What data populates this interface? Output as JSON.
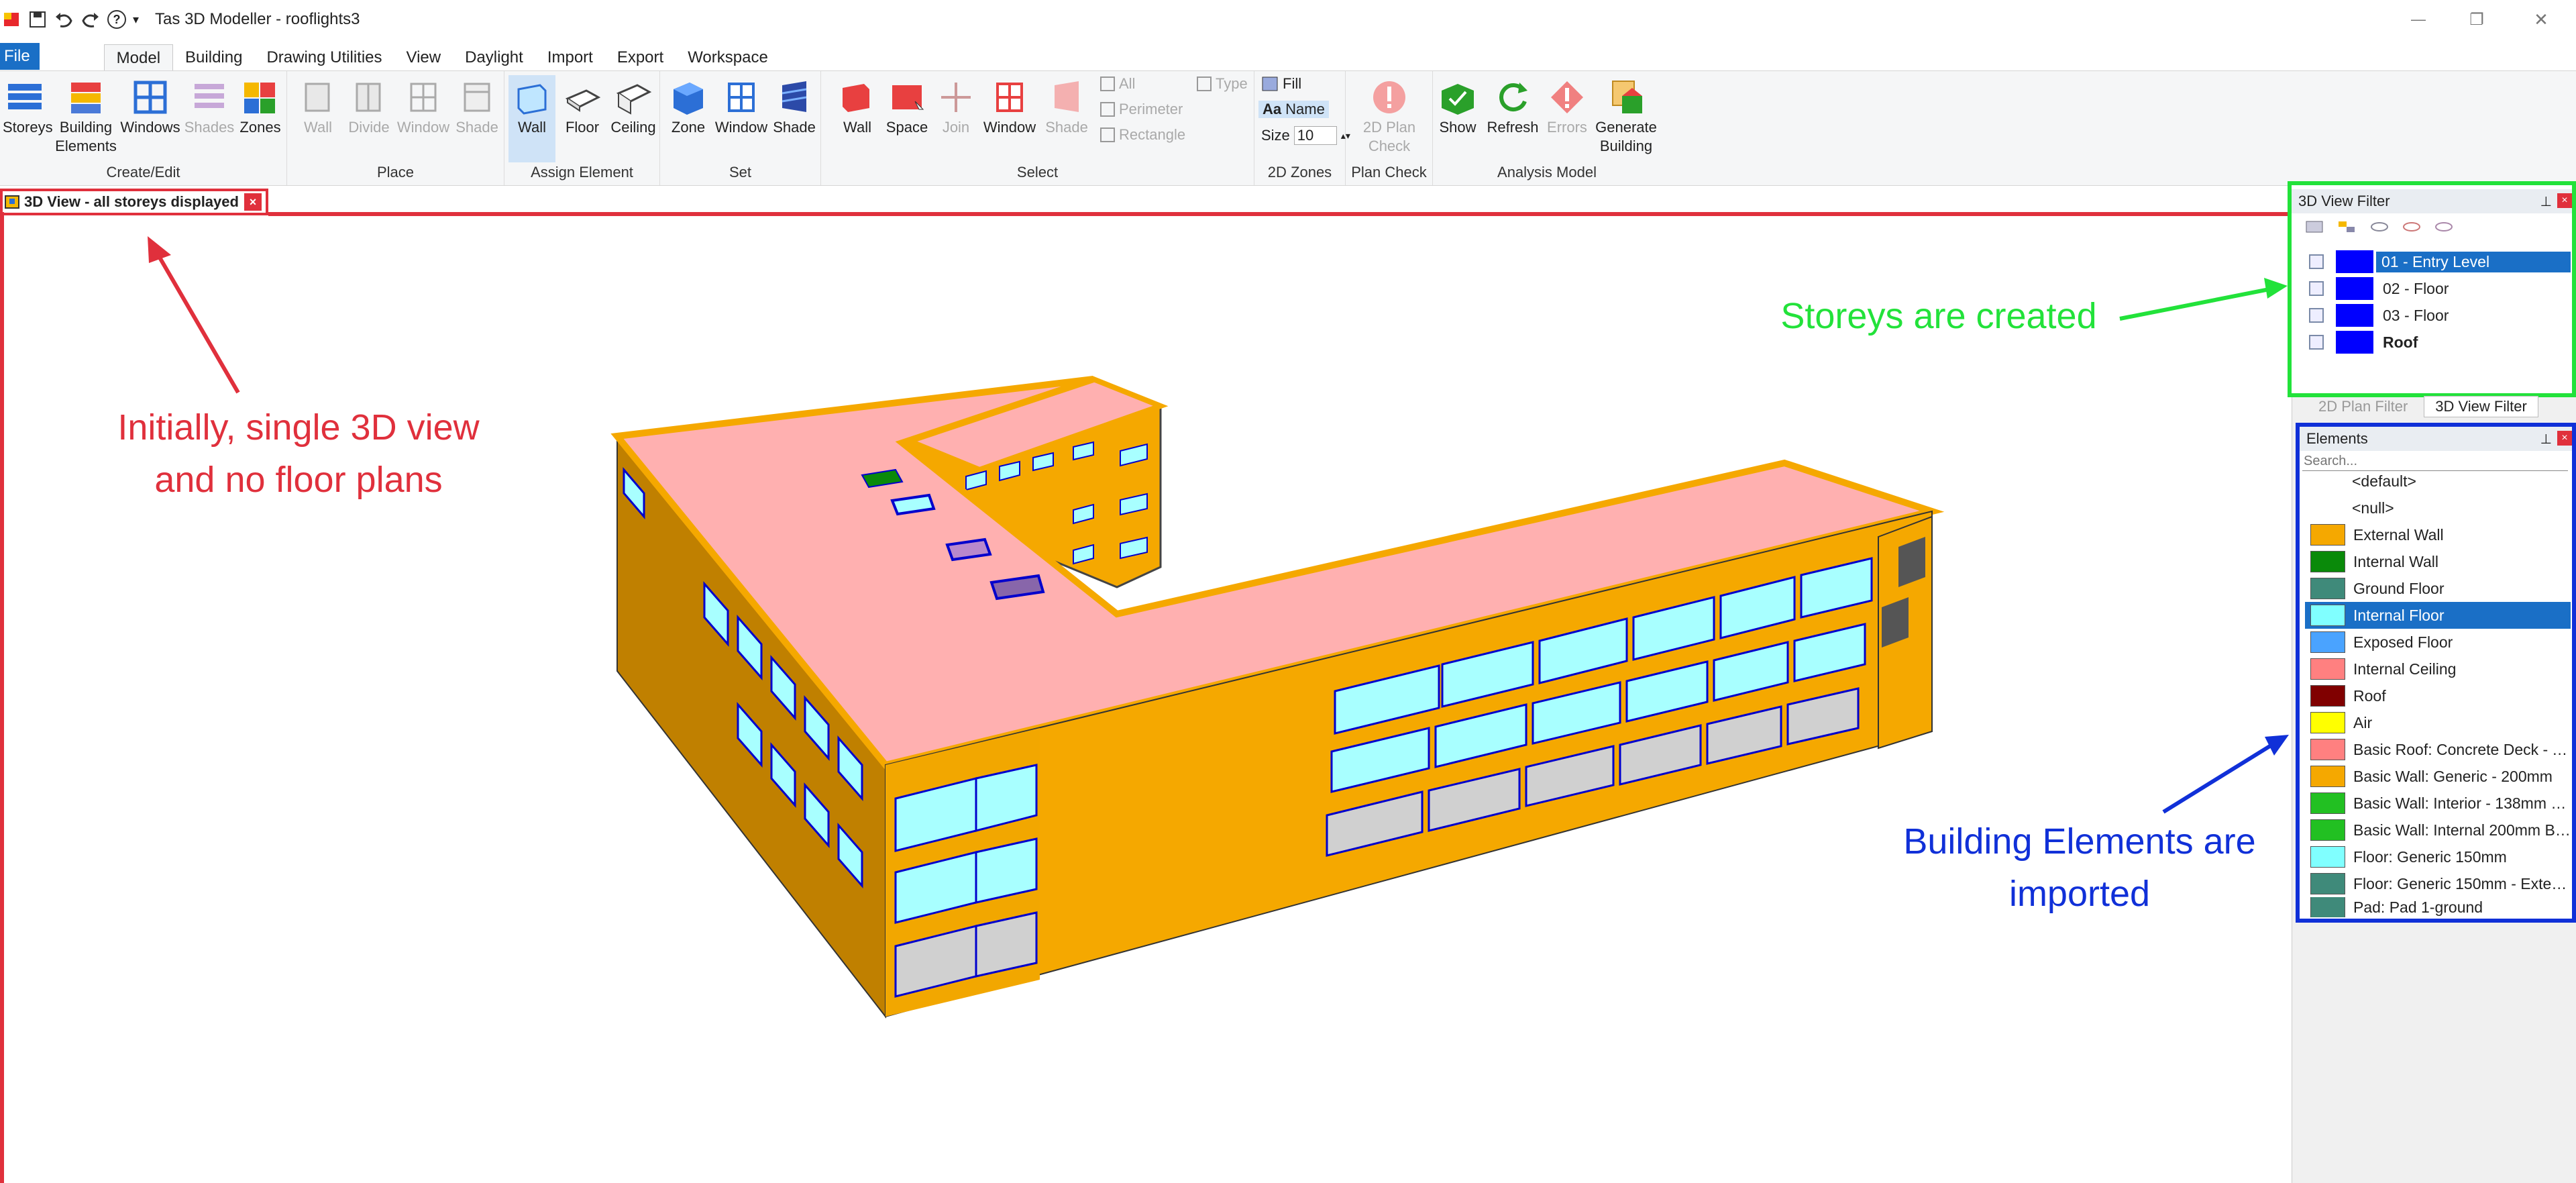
{
  "window": {
    "title": "Tas 3D Modeller - rooflights3",
    "help_glyph": "?",
    "qat_more": "▾",
    "minimize": "—",
    "restore": "❐",
    "close": "✕"
  },
  "menu": {
    "file": "File",
    "tabs": [
      "Model",
      "Building",
      "Drawing Utilities",
      "View",
      "Daylight",
      "Import",
      "Export",
      "Workspace"
    ],
    "active": "Model"
  },
  "ribbon": {
    "groups": {
      "create_edit": {
        "label": "Create/Edit",
        "buttons": [
          "Storeys",
          "Building Elements",
          "Windows",
          "Shades",
          "Zones"
        ]
      },
      "place": {
        "label": "Place",
        "buttons": [
          "Wall",
          "Divide",
          "Window",
          "Shade"
        ]
      },
      "assign_element": {
        "label": "Assign Element",
        "buttons": [
          "Wall",
          "Floor",
          "Ceiling"
        ]
      },
      "set": {
        "label": "Set",
        "buttons": [
          "Zone",
          "Window",
          "Shade"
        ]
      },
      "select": {
        "label": "Select",
        "buttons": [
          "Wall",
          "Space",
          "Join",
          "Window",
          "Shade"
        ],
        "small": [
          "All",
          "Perimeter",
          "Rectangle",
          "Type"
        ]
      },
      "zones_2d": {
        "label": "2D Zones",
        "fill": "Fill",
        "name": "Name",
        "size_label": "Size",
        "size_value": "10"
      },
      "plan_check": {
        "label": "Plan Check",
        "button": "2D Plan Check"
      },
      "analysis_model": {
        "label": "Analysis Model",
        "buttons": [
          "Show",
          "Refresh",
          "Errors",
          "Generate Building"
        ]
      }
    }
  },
  "document": {
    "tab_title": "3D View - all storeys displayed",
    "tab_close": "×"
  },
  "view_filter": {
    "title": "3D View Filter",
    "pin": "⊥",
    "close": "×",
    "storeys": [
      {
        "label": "01 - Entry Level",
        "selected": true
      },
      {
        "label": "02 - Floor",
        "selected": false
      },
      {
        "label": "03 - Floor",
        "selected": false
      },
      {
        "label": "Roof",
        "selected": false,
        "bold": true
      }
    ],
    "tabs": [
      "2D Plan Filter",
      "3D View Filter"
    ]
  },
  "elements_panel": {
    "title": "Elements",
    "pin": "⊥",
    "close": "×",
    "search_placeholder": "Search...",
    "items": [
      {
        "label": "<default>",
        "color": null
      },
      {
        "label": "<null>",
        "color": null
      },
      {
        "label": "External Wall",
        "color": "#f5a800"
      },
      {
        "label": "Internal Wall",
        "color": "#0a8a0a"
      },
      {
        "label": "Ground Floor",
        "color": "#3f8a7a"
      },
      {
        "label": "Internal Floor",
        "color": "#80ffff",
        "selected": true
      },
      {
        "label": "Exposed Floor",
        "color": "#4aa3ff"
      },
      {
        "label": "Internal Ceiling",
        "color": "#ff8080"
      },
      {
        "label": "Roof",
        "color": "#800000"
      },
      {
        "label": "Air",
        "color": "#ffff00"
      },
      {
        "label": "Basic Roof: Concrete Deck - T...",
        "color": "#ff8080"
      },
      {
        "label": "Basic Wall: Generic - 200mm",
        "color": "#f5a800"
      },
      {
        "label": "Basic Wall: Interior - 138mm P...",
        "color": "#22c022"
      },
      {
        "label": "Basic Wall: Internal 200mm Bl...",
        "color": "#22c022"
      },
      {
        "label": "Floor: Generic 150mm",
        "color": "#80ffff"
      },
      {
        "label": "Floor: Generic 150mm - Exteri...",
        "color": "#3f8a7a"
      },
      {
        "label": "Pad: Pad 1-ground",
        "color": "#3f8a7a"
      }
    ]
  },
  "annotations": {
    "left_line1": "Initially, single 3D view",
    "left_line2": "and no floor plans",
    "storeys": "Storeys are created",
    "elements_line1": "Building Elements are",
    "elements_line2": "imported"
  },
  "colors": {
    "accent_blue": "#1a6fc6",
    "annotation_red": "#e0303c",
    "annotation_green": "#22e23a",
    "annotation_blue": "#1030d8",
    "wall_orange": "#f5a800",
    "roof_pink": "#ffb0b0",
    "glass": "#a8ffff"
  }
}
